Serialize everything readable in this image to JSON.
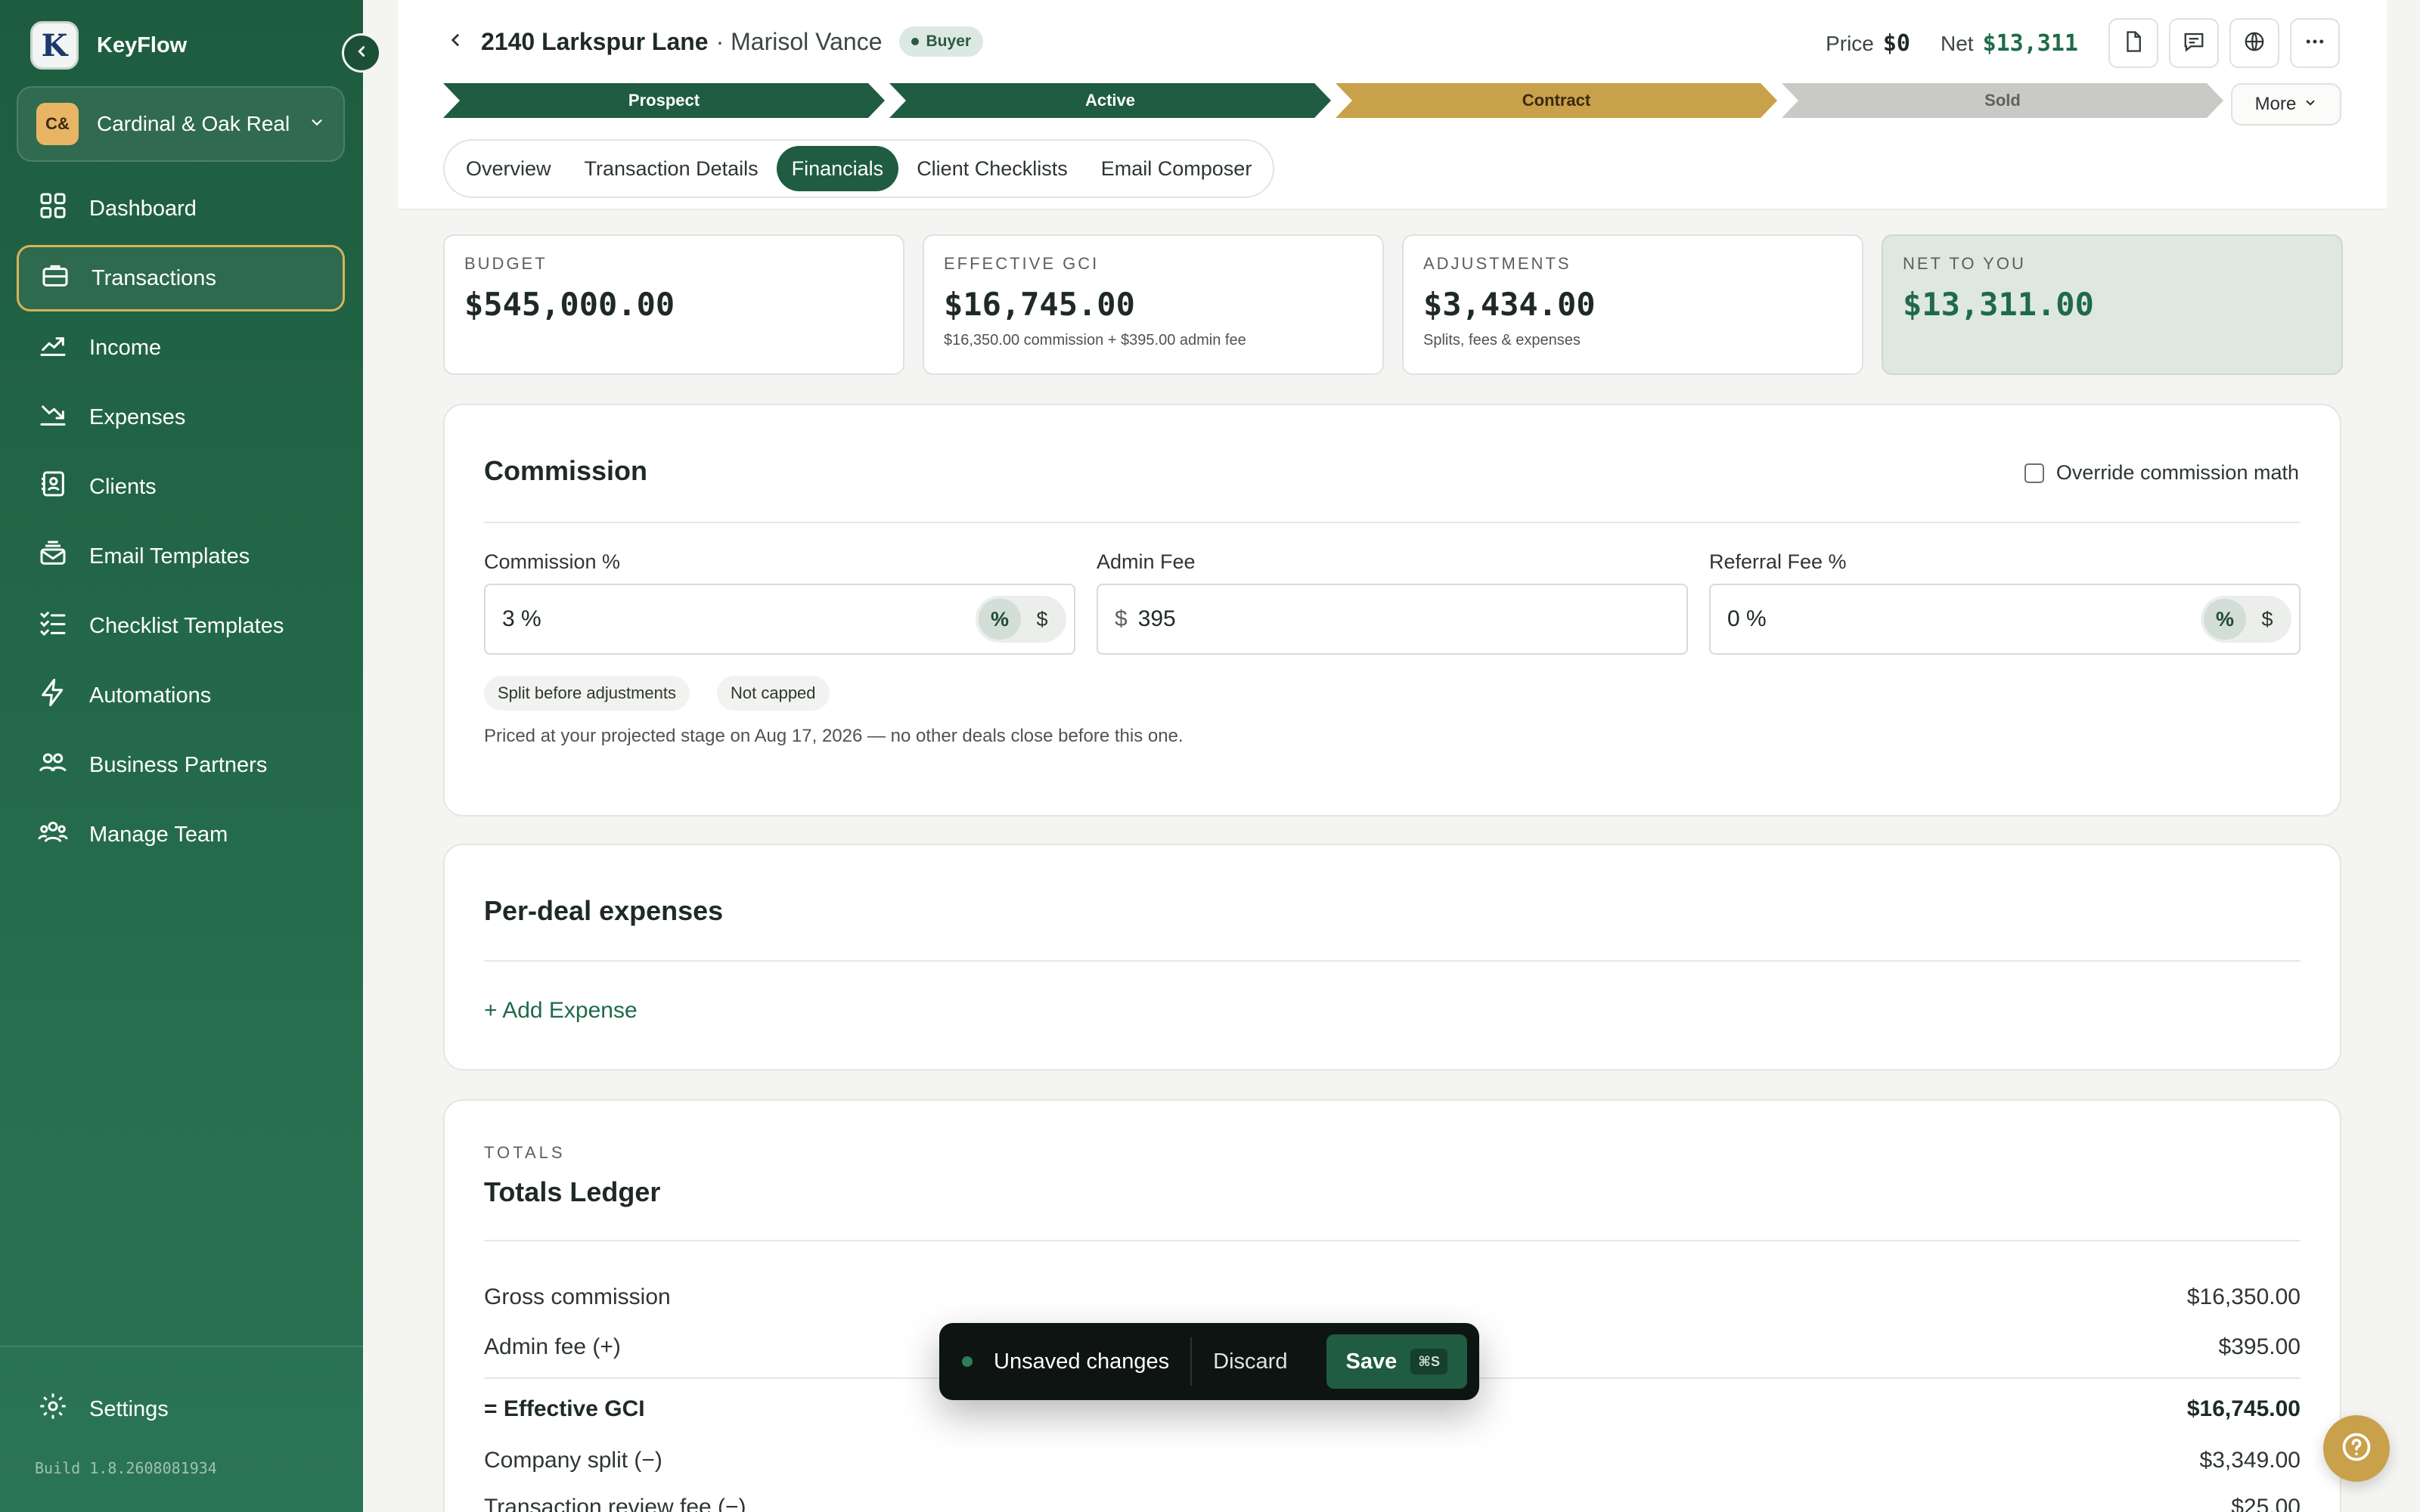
{
  "app": {
    "name": "KeyFlow",
    "logo_letter": "K",
    "org_badge": "C&",
    "org_name": "Cardinal & Oak Real...",
    "build": "Build 1.8.2608081934"
  },
  "sidebar": {
    "items": [
      {
        "label": "Dashboard",
        "icon": "dashboard-icon",
        "active": false
      },
      {
        "label": "Transactions",
        "icon": "briefcase-icon",
        "active": true
      },
      {
        "label": "Income",
        "icon": "trend-up-icon",
        "active": false
      },
      {
        "label": "Expenses",
        "icon": "trend-down-icon",
        "active": false
      },
      {
        "label": "Clients",
        "icon": "contacts-book-icon",
        "active": false
      },
      {
        "label": "Email Templates",
        "icon": "mail-stack-icon",
        "active": false
      },
      {
        "label": "Checklist Templates",
        "icon": "checklist-icon",
        "active": false
      },
      {
        "label": "Automations",
        "icon": "bolt-icon",
        "active": false
      },
      {
        "label": "Business Partners",
        "icon": "partners-icon",
        "active": false
      },
      {
        "label": "Manage Team",
        "icon": "team-icon",
        "active": false
      }
    ],
    "settings_label": "Settings"
  },
  "header": {
    "address": "2140 Larkspur Lane",
    "client": "· Marisol Vance",
    "role_badge": "Buyer",
    "price_label": "Price",
    "price_value": "$0",
    "net_label": "Net",
    "net_value": "$13,311",
    "stages": [
      {
        "label": "Prospect",
        "state": "done"
      },
      {
        "label": "Active",
        "state": "done"
      },
      {
        "label": "Contract",
        "state": "current"
      },
      {
        "label": "Sold",
        "state": "todo"
      }
    ],
    "more_label": "More",
    "tabs": [
      {
        "label": "Overview",
        "active": false
      },
      {
        "label": "Transaction Details",
        "active": false
      },
      {
        "label": "Financials",
        "active": true
      },
      {
        "label": "Client Checklists",
        "active": false
      },
      {
        "label": "Email Composer",
        "active": false
      }
    ]
  },
  "stats": [
    {
      "label": "BUDGET",
      "value": "$545,000.00",
      "sub": ""
    },
    {
      "label": "EFFECTIVE GCI",
      "value": "$16,745.00",
      "sub": "$16,350.00 commission + $395.00 admin fee"
    },
    {
      "label": "ADJUSTMENTS",
      "value": "$3,434.00",
      "sub": "Splits, fees & expenses"
    },
    {
      "label": "NET TO YOU",
      "value": "$13,311.00",
      "sub": ""
    }
  ],
  "commission": {
    "title": "Commission",
    "override_label": "Override commission math",
    "override_checked": false,
    "commission_pct_label": "Commission %",
    "commission_pct_value": "3 %",
    "admin_fee_label": "Admin Fee",
    "admin_fee_prefix": "$",
    "admin_fee_value": "395",
    "referral_label": "Referral Fee %",
    "referral_value": "0 %",
    "unit_pct": "%",
    "unit_dollar": "$",
    "chip_split": "Split before adjustments",
    "chip_cap": "Not capped",
    "note": "Priced at your projected stage on Aug 17, 2026 — no other deals close before this one."
  },
  "expenses": {
    "title": "Per-deal expenses",
    "add_label": "+ Add Expense"
  },
  "ledger": {
    "eyebrow": "TOTALS",
    "title": "Totals Ledger",
    "rows": [
      {
        "label": "Gross commission",
        "value": "$16,350.00"
      },
      {
        "label": "Admin fee (+)",
        "value": "$395.00"
      },
      {
        "label": "= Effective GCI",
        "value": "$16,745.00"
      },
      {
        "label": "Company split (−)",
        "value": "$3,349.00"
      },
      {
        "label": "Transaction review fee (−)",
        "value": "$25.00"
      }
    ]
  },
  "savebar": {
    "message": "Unsaved changes",
    "discard_label": "Discard",
    "save_label": "Save",
    "shortcut": "⌘S"
  },
  "colors": {
    "brand_green": "#1f5c41",
    "accent_gold": "#c9a14a",
    "net_green": "#1f6a49"
  }
}
